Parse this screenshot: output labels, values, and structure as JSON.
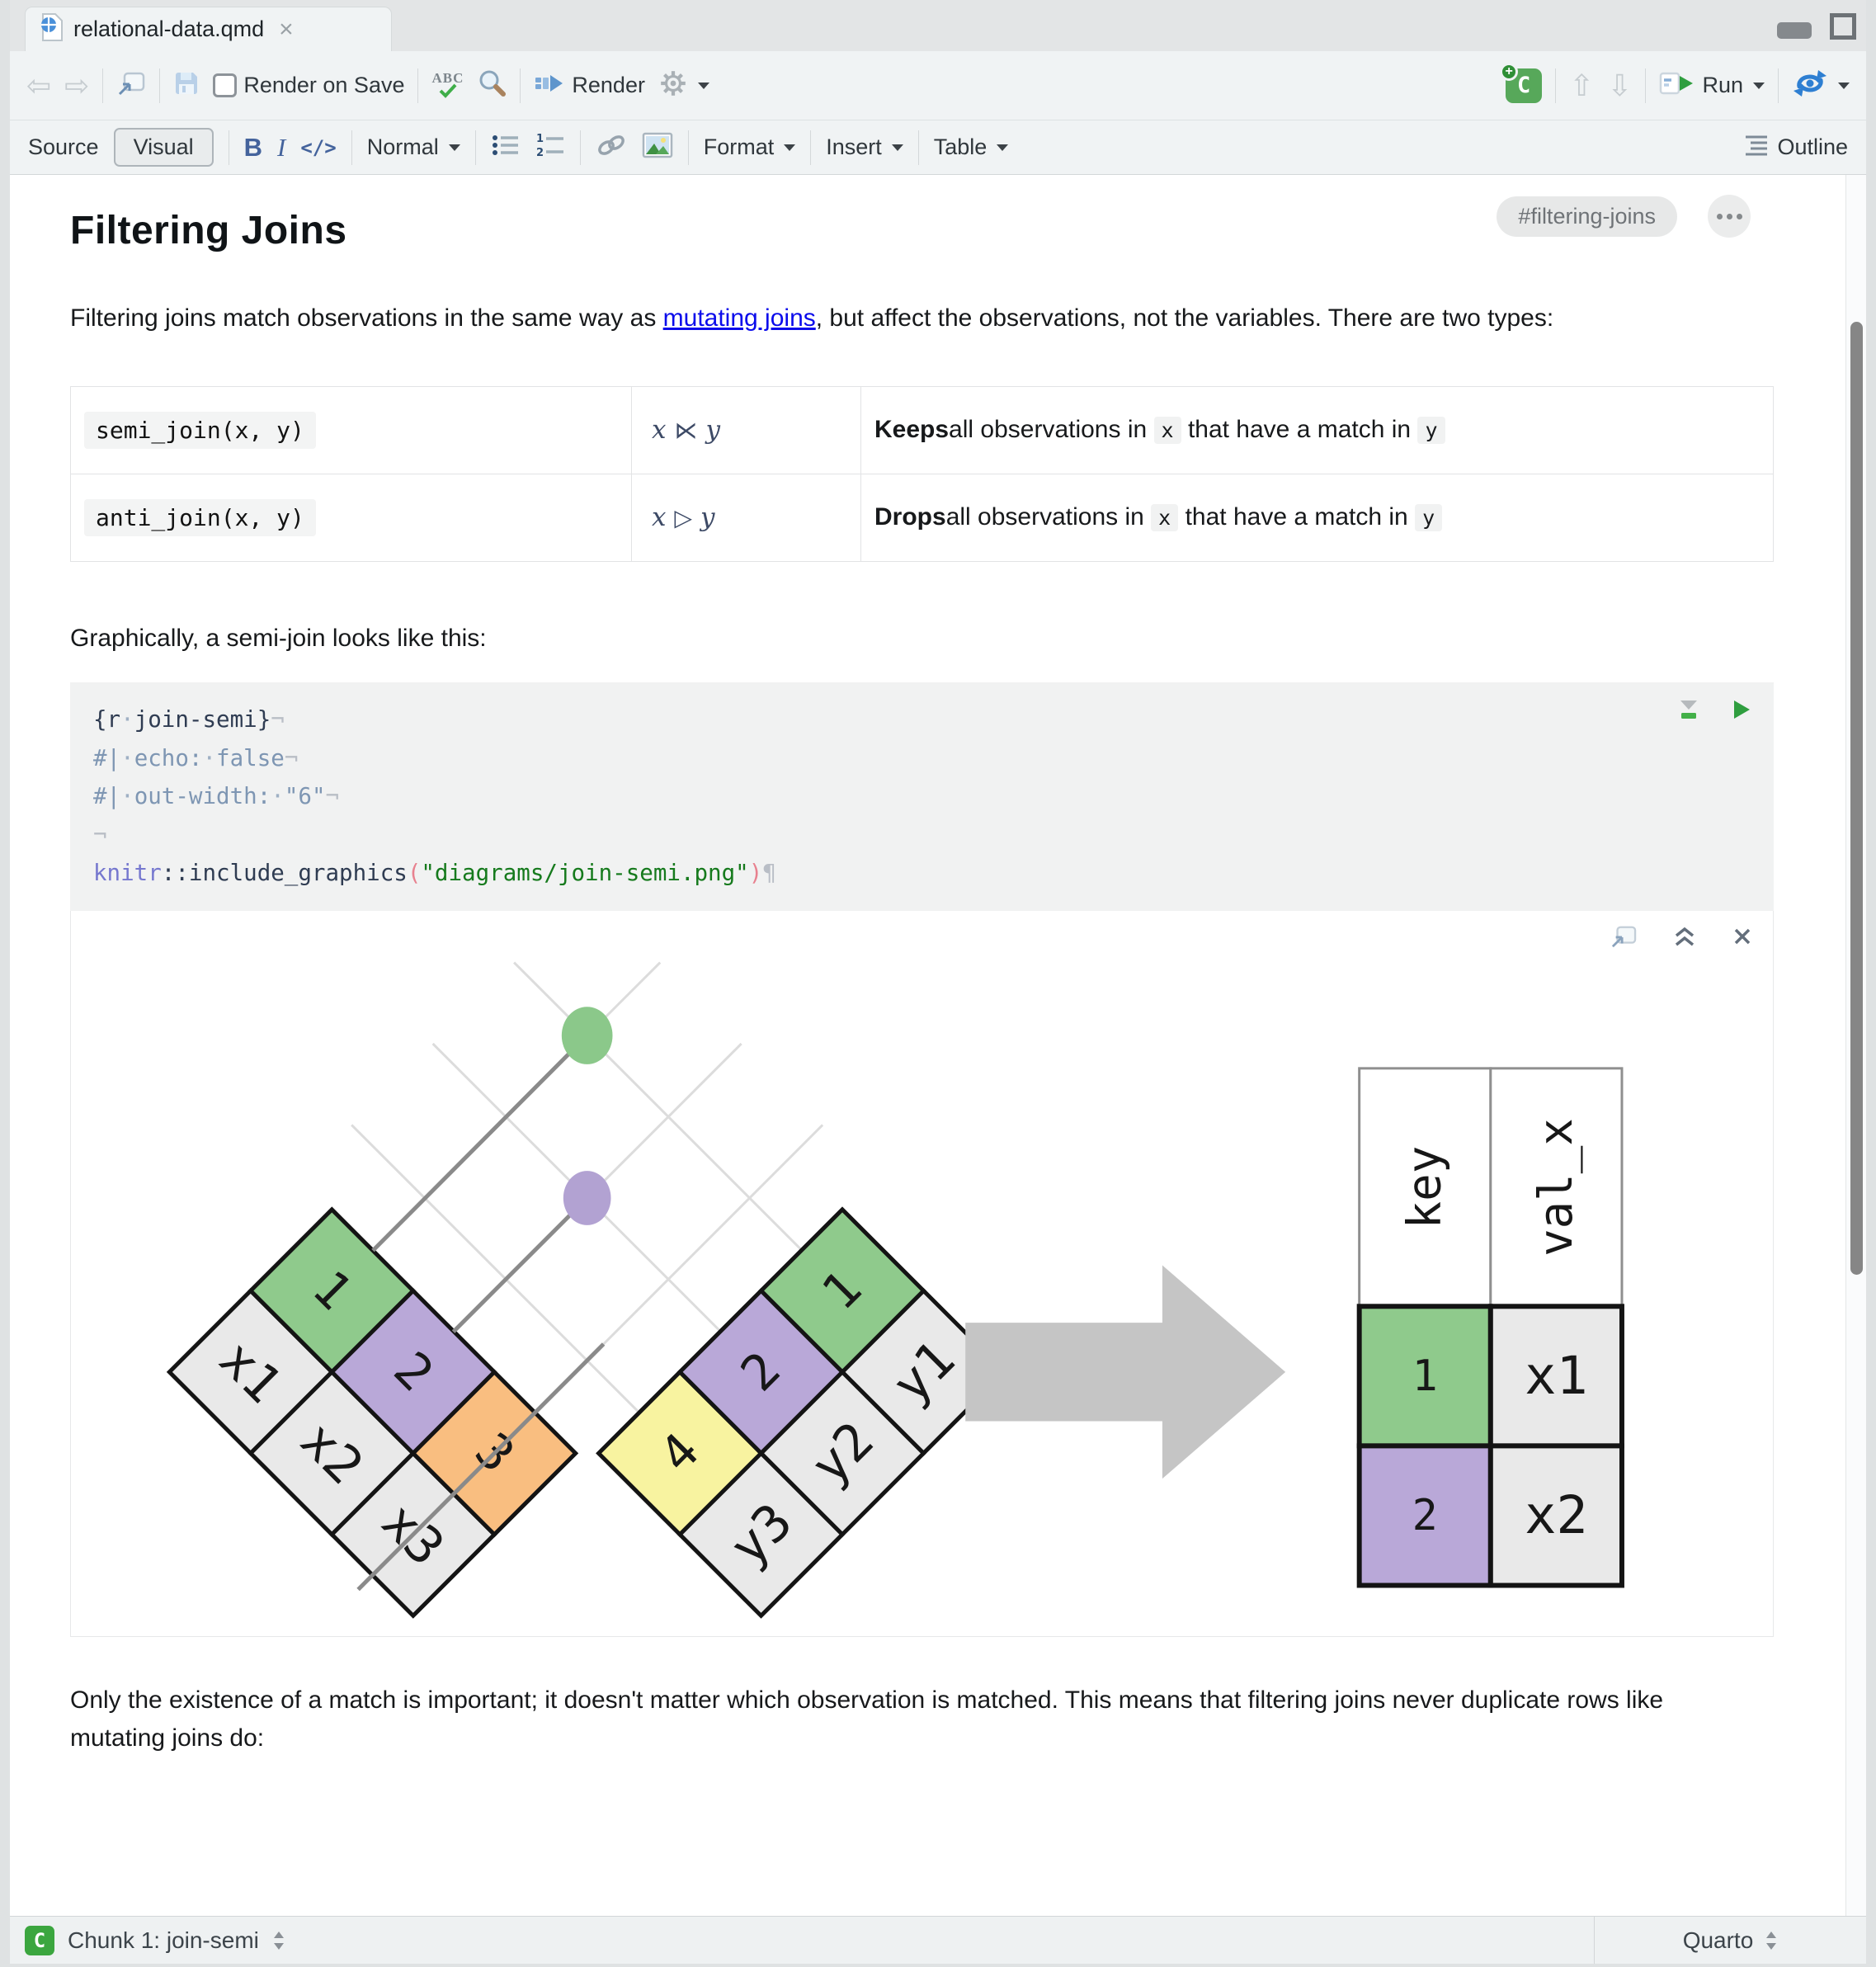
{
  "tab": {
    "title": "relational-data.qmd",
    "close_glyph": "×"
  },
  "toolbar": {
    "back_glyph": "⇦",
    "forward_glyph": "⇨",
    "render_on_save_label": "Render on Save",
    "spellcheck_label": "ABC",
    "render_label": "Render",
    "new_chunk_label": "C",
    "up_glyph": "⇧",
    "down_glyph": "⇩",
    "run_label": "Run"
  },
  "format_bar": {
    "source_label": "Source",
    "visual_label": "Visual",
    "bold_glyph": "B",
    "italic_glyph": "I",
    "code_glyph": "</>",
    "paragraph_style": "Normal",
    "format_label": "Format",
    "insert_label": "Insert",
    "table_label": "Table",
    "outline_label": "Outline"
  },
  "document": {
    "section_anchor": "#filtering-joins",
    "heading": "Filtering Joins",
    "intro_before": "Filtering joins match observations in the same way as ",
    "intro_link": "mutating joins",
    "intro_after": ", but affect the observations, not the variables. There are two types:",
    "join_table": {
      "rows": [
        {
          "code": "semi_join(x, y)",
          "math_x": "x",
          "math_op": "⋉",
          "math_y": "y",
          "verb": "Keeps",
          "desc1": " all observations in ",
          "code1": "x",
          "desc2": " that have a match in ",
          "code2": "y"
        },
        {
          "code": "anti_join(x, y)",
          "math_x": "x",
          "math_op": "▷",
          "math_y": "y",
          "verb": "Drops",
          "desc1": " all observations in ",
          "code1": "x",
          "desc2": " that have a match in ",
          "code2": "y"
        }
      ]
    },
    "graphically": "Graphically, a semi-join looks like this:",
    "closing": "Only the existence of a match is important; it doesn't matter which observation is matched. This means that filtering joins never duplicate rows like mutating joins do:"
  },
  "chunk": {
    "token_colors": {
      "navy": "#2f3c52",
      "meta": "#7e96b3",
      "dot": "#9fb0c4",
      "ghost": "#b9bec6",
      "pkg": "#7678cf",
      "paren": "#e8818f",
      "str": "#167a1d"
    },
    "lines": [
      [
        {
          "t": "{r",
          "c": "navy"
        },
        {
          "t": "·",
          "c": "dot"
        },
        {
          "t": "join-semi}",
          "c": "navy"
        },
        {
          "t": "¬",
          "c": "ghost"
        }
      ],
      [
        {
          "t": "#|",
          "c": "meta"
        },
        {
          "t": "·",
          "c": "dot"
        },
        {
          "t": "echo:",
          "c": "meta"
        },
        {
          "t": "·",
          "c": "dot"
        },
        {
          "t": "false",
          "c": "meta"
        },
        {
          "t": "¬",
          "c": "ghost"
        }
      ],
      [
        {
          "t": "#|",
          "c": "meta"
        },
        {
          "t": "·",
          "c": "dot"
        },
        {
          "t": "out-width:",
          "c": "meta"
        },
        {
          "t": "·",
          "c": "dot"
        },
        {
          "t": "\"6\"",
          "c": "meta"
        },
        {
          "t": "¬",
          "c": "ghost"
        }
      ],
      [
        {
          "t": "¬",
          "c": "ghost"
        }
      ],
      [
        {
          "t": "knitr",
          "c": "pkg"
        },
        {
          "t": "::include_graphics",
          "c": "navy"
        },
        {
          "t": "(",
          "c": "paren"
        },
        {
          "t": "\"diagrams/join-semi.png\"",
          "c": "str"
        },
        {
          "t": ")",
          "c": "paren"
        },
        {
          "t": "¶",
          "c": "ghost"
        }
      ]
    ]
  },
  "diagram": {
    "cell_gray": "#e9e9e9",
    "lattice_color": "#dcdcdc",
    "match_line_color": "#8a8a8a",
    "arrow_color": "#c5c5c5",
    "x_table": {
      "keys": [
        {
          "v": "1",
          "color": "#8fca8c"
        },
        {
          "v": "2",
          "color": "#b9a8d8"
        },
        {
          "v": "3",
          "color": "#f9be80"
        }
      ],
      "vals": [
        "x1",
        "x2",
        "x3"
      ]
    },
    "y_table": {
      "keys": [
        {
          "v": "1",
          "color": "#8fca8c"
        },
        {
          "v": "2",
          "color": "#b9a8d8"
        },
        {
          "v": "4",
          "color": "#f8f3a0"
        }
      ],
      "vals": [
        "y1",
        "y2",
        "y3"
      ]
    },
    "dots": [
      {
        "name": "match-dot-key1",
        "color": "#8bc88a"
      },
      {
        "name": "match-dot-key2",
        "color": "#b2a2d2"
      }
    ],
    "result": {
      "headers": [
        "key",
        "val_x"
      ],
      "rows": [
        {
          "key": "1",
          "key_color": "#8fca8c",
          "val": "x1"
        },
        {
          "key": "2",
          "key_color": "#b9a8d8",
          "val": "x2"
        }
      ]
    }
  },
  "statusbar": {
    "chunk_label": "Chunk 1: join-semi",
    "mode_label": "Quarto"
  },
  "colors": {
    "link": "#0b0beb",
    "chunk_bg": "#f1f2f2",
    "toolbar_bg": "#f0f3f4",
    "run_green": "#2f9e3f",
    "render_blue": "#5e95cc"
  }
}
